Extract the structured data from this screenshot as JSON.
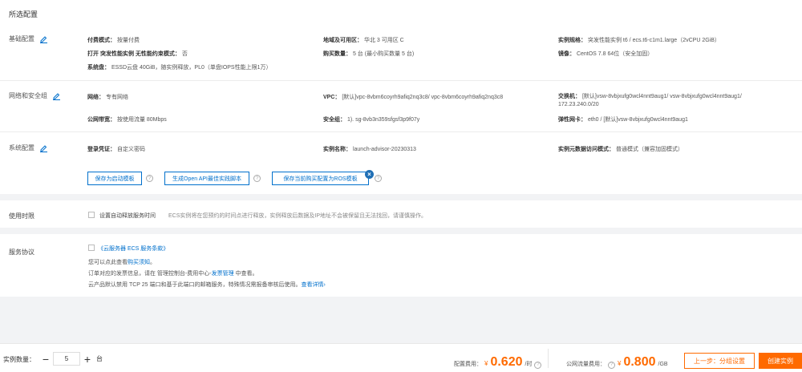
{
  "summary": {
    "title": "所选配置",
    "basic": {
      "label": "基础配置",
      "billing_k": "付费模式：",
      "billing_v": "按量付费",
      "region_k": "地域及可用区：",
      "region_v": "华北 3 可用区 C",
      "spec_k": "实例规格：",
      "spec_v": "突发性能实例 t6 / ecs.t6-c1m1.large（2vCPU 2GiB）",
      "unlimited_k": "打开 突发性能实例 无性能约束模式：",
      "unlimited_v": "否",
      "qty_k": "购买数量：",
      "qty_v": "5 台 (最小购买数量 5 台)",
      "image_k": "镜像：",
      "image_v": "CentOS 7.8 64位（安全加固）",
      "disk_k": "系统盘：",
      "disk_v": "ESSD云盘 40GiB，随实例释放，PL0（单盘IOPS性能上限1万）"
    },
    "network": {
      "label": "网络和安全组",
      "net_k": "网络：",
      "net_v": "专有网络",
      "vpc_k": "VPC：",
      "vpc_v": "[默认]vpc-8vbm6coyrh9afiq2nq3c8/ vpc-8vbm6coyrh9afiq2nq3c8",
      "vsw_k": "交换机：",
      "vsw_v": "[默认]vsw-8vbjxufg0wcl4nnt9aug1/ vsw-8vbjxufg0wcl4nnt9aug1/ 172.23.240.0/20",
      "bw_k": "公网带宽：",
      "bw_v": "按使用流量 80Mbps",
      "sg_k": "安全组：",
      "sg_v": "1). sg-8vb3n359sfgsf3p9f07y",
      "eni_k": "弹性网卡：",
      "eni_v": "eth0 / [默认]vsw-8vbjxufg0wcl4nnt9aug1"
    },
    "system": {
      "label": "系统配置",
      "login_k": "登录凭证：",
      "login_v": "自定义密码",
      "name_k": "实例名称：",
      "name_v": "launch-advisor-20230313",
      "meta_k": "实例元数据访问模式：",
      "meta_v": "普通模式（兼容加固模式）"
    },
    "buttons": {
      "save_template": "保存为启动模板",
      "gen_api": "生成Open API最佳实践脚本",
      "save_ros": "保存当前购买配置为ROS模板"
    }
  },
  "usage": {
    "label": "使用时限",
    "checkbox_label": "设置自动释放服务时间",
    "note": "ECS实例将在您预约的时间点进行释放，实例释放后数据及IP地址不会被保留且无法找回，请谨慎操作。"
  },
  "agreement": {
    "label": "服务协议",
    "terms_link": "《云服务器 ECS 服务条款》",
    "line1_pre": "您可以点此查看",
    "line1_link": "购买须知",
    "line1_post": "。",
    "line2_pre": "订单对应的发票信息，请在 管理控制台-费用中心-",
    "line2_link": "发票管理",
    "line2_post": " 中查看。",
    "line3_pre": "云产品默认禁用 TCP 25 端口和基于此端口的邮箱服务，特殊情况需报备审核后使用。",
    "line3_link": "查看详情",
    "line3_post": "›"
  },
  "footer": {
    "qty_label": "实例数量：",
    "qty_value": "5",
    "qty_unit": "台",
    "minus": "−",
    "plus": "+",
    "fee_label": "配置费用：",
    "fee_currency": "¥",
    "fee_amount": "0.620",
    "fee_unit": "/时",
    "traffic_label": "公网流量费用：",
    "traffic_currency": "¥",
    "traffic_amount": "0.800",
    "traffic_unit": "/GB",
    "prev_button": "上一步：分组设置",
    "create_button": "创建实例"
  },
  "colors": {
    "accent": "#0070cc",
    "price": "#ff6a00",
    "badge": "#1f6fb5"
  }
}
